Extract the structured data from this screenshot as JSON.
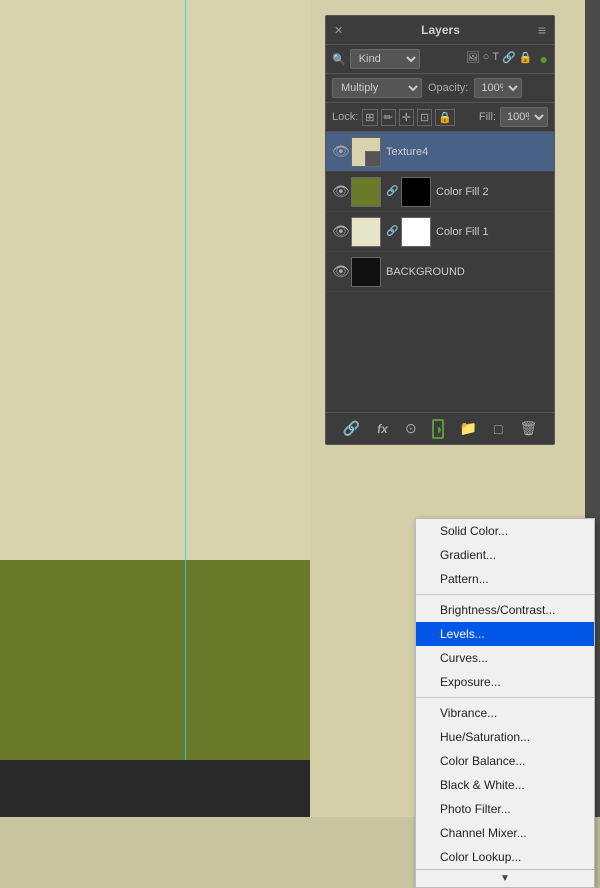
{
  "canvas": {
    "guide_color": "#00e5ff"
  },
  "panel": {
    "title": "Layers",
    "close_symbol": "✕",
    "menu_symbol": "≡"
  },
  "filter_row": {
    "kind_label": "Kind",
    "icons": [
      "🖼",
      "○",
      "T",
      "🔗",
      "🔒"
    ]
  },
  "blend_row": {
    "blend_mode": "Multiply",
    "opacity_label": "Opacity:",
    "opacity_value": "100%"
  },
  "lock_row": {
    "lock_label": "Lock:",
    "fill_label": "Fill:",
    "fill_value": "100%"
  },
  "layers": [
    {
      "name": "Texture4",
      "type": "texture",
      "selected": true,
      "visible": true
    },
    {
      "name": "Color Fill 2",
      "type": "color_fill_green",
      "selected": false,
      "visible": true
    },
    {
      "name": "Color Fill 1",
      "type": "color_fill_cream",
      "selected": false,
      "visible": true
    },
    {
      "name": "BACKGROUND",
      "type": "background",
      "selected": false,
      "visible": true
    }
  ],
  "toolbar": {
    "link_icon": "🔗",
    "fx_label": "fx",
    "circle_icon": "⊙",
    "adjust_icon": "◑",
    "folder_icon": "📁",
    "new_icon": "□",
    "trash_icon": "🗑"
  },
  "dropdown_menu": {
    "items": [
      {
        "label": "Solid Color...",
        "checked": false,
        "highlighted": false
      },
      {
        "label": "Gradient...",
        "checked": false,
        "highlighted": false
      },
      {
        "label": "Pattern...",
        "checked": false,
        "highlighted": false
      },
      {
        "separator": true
      },
      {
        "label": "Brightness/Contrast...",
        "checked": false,
        "highlighted": false
      },
      {
        "label": "Levels...",
        "checked": false,
        "highlighted": true
      },
      {
        "label": "Curves...",
        "checked": false,
        "highlighted": false
      },
      {
        "label": "Exposure...",
        "checked": false,
        "highlighted": false
      },
      {
        "separator": true
      },
      {
        "label": "Vibrance...",
        "checked": false,
        "highlighted": false
      },
      {
        "label": "Hue/Saturation...",
        "checked": false,
        "highlighted": false
      },
      {
        "label": "Color Balance...",
        "checked": false,
        "highlighted": false
      },
      {
        "label": "Black & White...",
        "checked": false,
        "highlighted": false
      },
      {
        "label": "Photo Filter...",
        "checked": false,
        "highlighted": false
      },
      {
        "label": "Channel Mixer...",
        "checked": false,
        "highlighted": false
      },
      {
        "label": "Color Lookup...",
        "checked": false,
        "highlighted": false
      }
    ],
    "arrow": "▼"
  }
}
